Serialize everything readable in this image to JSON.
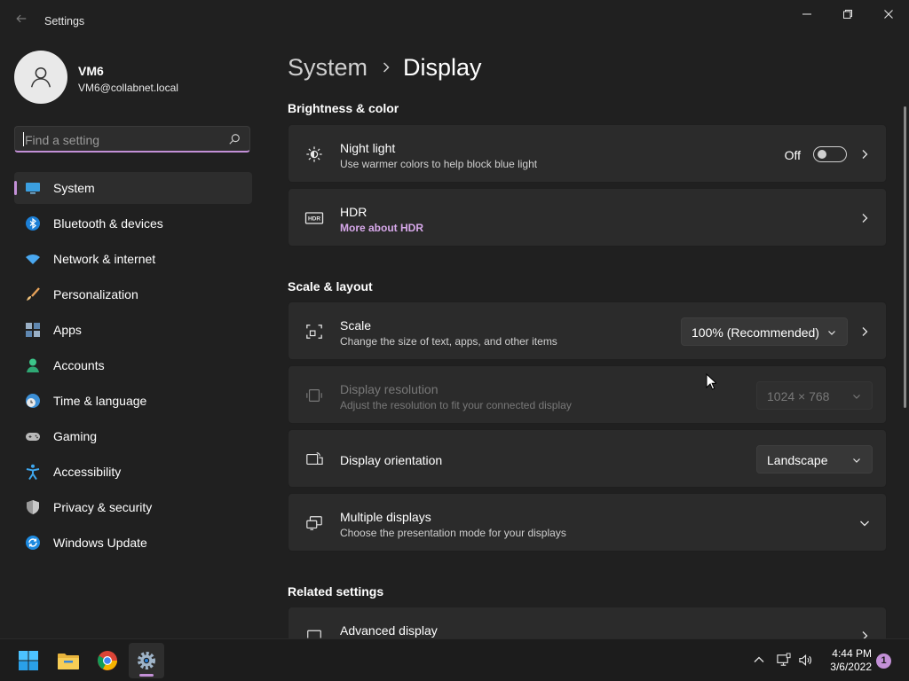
{
  "window": {
    "title": "Settings"
  },
  "user": {
    "name": "VM6",
    "email": "VM6@collabnet.local"
  },
  "search": {
    "placeholder": "Find a setting"
  },
  "sidebar": {
    "items": [
      {
        "label": "System",
        "icon": "monitor-icon",
        "active": true
      },
      {
        "label": "Bluetooth & devices",
        "icon": "bluetooth-icon"
      },
      {
        "label": "Network & internet",
        "icon": "wifi-icon"
      },
      {
        "label": "Personalization",
        "icon": "brush-icon"
      },
      {
        "label": "Apps",
        "icon": "apps-icon"
      },
      {
        "label": "Accounts",
        "icon": "person-icon"
      },
      {
        "label": "Time & language",
        "icon": "clock-globe-icon"
      },
      {
        "label": "Gaming",
        "icon": "gamepad-icon"
      },
      {
        "label": "Accessibility",
        "icon": "accessibility-icon"
      },
      {
        "label": "Privacy & security",
        "icon": "shield-icon"
      },
      {
        "label": "Windows Update",
        "icon": "update-icon"
      }
    ]
  },
  "breadcrumb": {
    "parent": "System",
    "current": "Display"
  },
  "sections": {
    "brightness": "Brightness & color",
    "scale_layout": "Scale & layout",
    "related": "Related settings"
  },
  "night_light": {
    "title": "Night light",
    "subtitle": "Use warmer colors to help block blue light",
    "state_label": "Off"
  },
  "hdr": {
    "title": "HDR",
    "link": "More about HDR"
  },
  "scale": {
    "title": "Scale",
    "subtitle": "Change the size of text, apps, and other items",
    "value": "100% (Recommended)"
  },
  "resolution": {
    "title": "Display resolution",
    "subtitle": "Adjust the resolution to fit your connected display",
    "value": "1024 × 768"
  },
  "orientation": {
    "title": "Display orientation",
    "value": "Landscape"
  },
  "multiple": {
    "title": "Multiple displays",
    "subtitle": "Choose the presentation mode for your displays"
  },
  "advanced": {
    "title": "Advanced display"
  },
  "taskbar": {
    "time": "4:44 PM",
    "date": "3/6/2022",
    "notifications": "1"
  },
  "colors": {
    "accent": "#c390d7",
    "background": "#202020",
    "card": "#2b2b2b"
  }
}
